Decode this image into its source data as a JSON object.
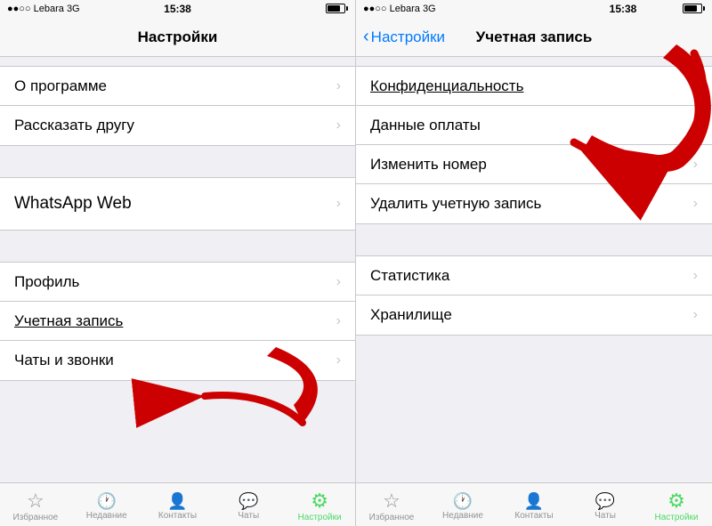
{
  "left": {
    "status": {
      "carrier": "●●○○ Lebara  3G",
      "time": "15:38"
    },
    "nav": {
      "title": "Настройки"
    },
    "items_group1": [
      {
        "label": "О программе",
        "id": "about"
      },
      {
        "label": "Рассказать другу",
        "id": "tell-friend"
      }
    ],
    "items_group2": [
      {
        "label": "WhatsApp Web",
        "id": "whatsapp-web"
      }
    ],
    "items_group3": [
      {
        "label": "Профиль",
        "id": "profile"
      },
      {
        "label": "Учетная запись",
        "id": "account",
        "underlined": true
      },
      {
        "label": "Чаты и звонки",
        "id": "chats"
      }
    ],
    "tabs": [
      {
        "label": "Избранное",
        "icon": "☆",
        "active": false
      },
      {
        "label": "Недавние",
        "icon": "🕐",
        "active": false
      },
      {
        "label": "Контакты",
        "icon": "👤",
        "active": false
      },
      {
        "label": "Чаты",
        "icon": "💬",
        "active": false
      },
      {
        "label": "Настройки",
        "icon": "⚙",
        "active": true
      }
    ]
  },
  "right": {
    "status": {
      "carrier": "●●○○ Lebara  3G",
      "time": "15:38"
    },
    "nav": {
      "back": "Настройки",
      "title": "Учетная запись"
    },
    "items_group1": [
      {
        "label": "Конфиденциальность",
        "id": "privacy",
        "underlined": true
      },
      {
        "label": "Данные оплаты",
        "id": "payment"
      },
      {
        "label": "Изменить номер",
        "id": "change-number"
      },
      {
        "label": "Удалить учетную запись",
        "id": "delete-account"
      }
    ],
    "items_group2": [
      {
        "label": "Статистика",
        "id": "statistics"
      },
      {
        "label": "Хранилище",
        "id": "storage"
      }
    ],
    "tabs": [
      {
        "label": "Избранное",
        "icon": "☆",
        "active": false
      },
      {
        "label": "Недавние",
        "icon": "🕐",
        "active": false
      },
      {
        "label": "Контакты",
        "icon": "👤",
        "active": false
      },
      {
        "label": "Чаты",
        "icon": "💬",
        "active": false
      },
      {
        "label": "Настройки",
        "icon": "⚙",
        "active": true
      }
    ]
  }
}
